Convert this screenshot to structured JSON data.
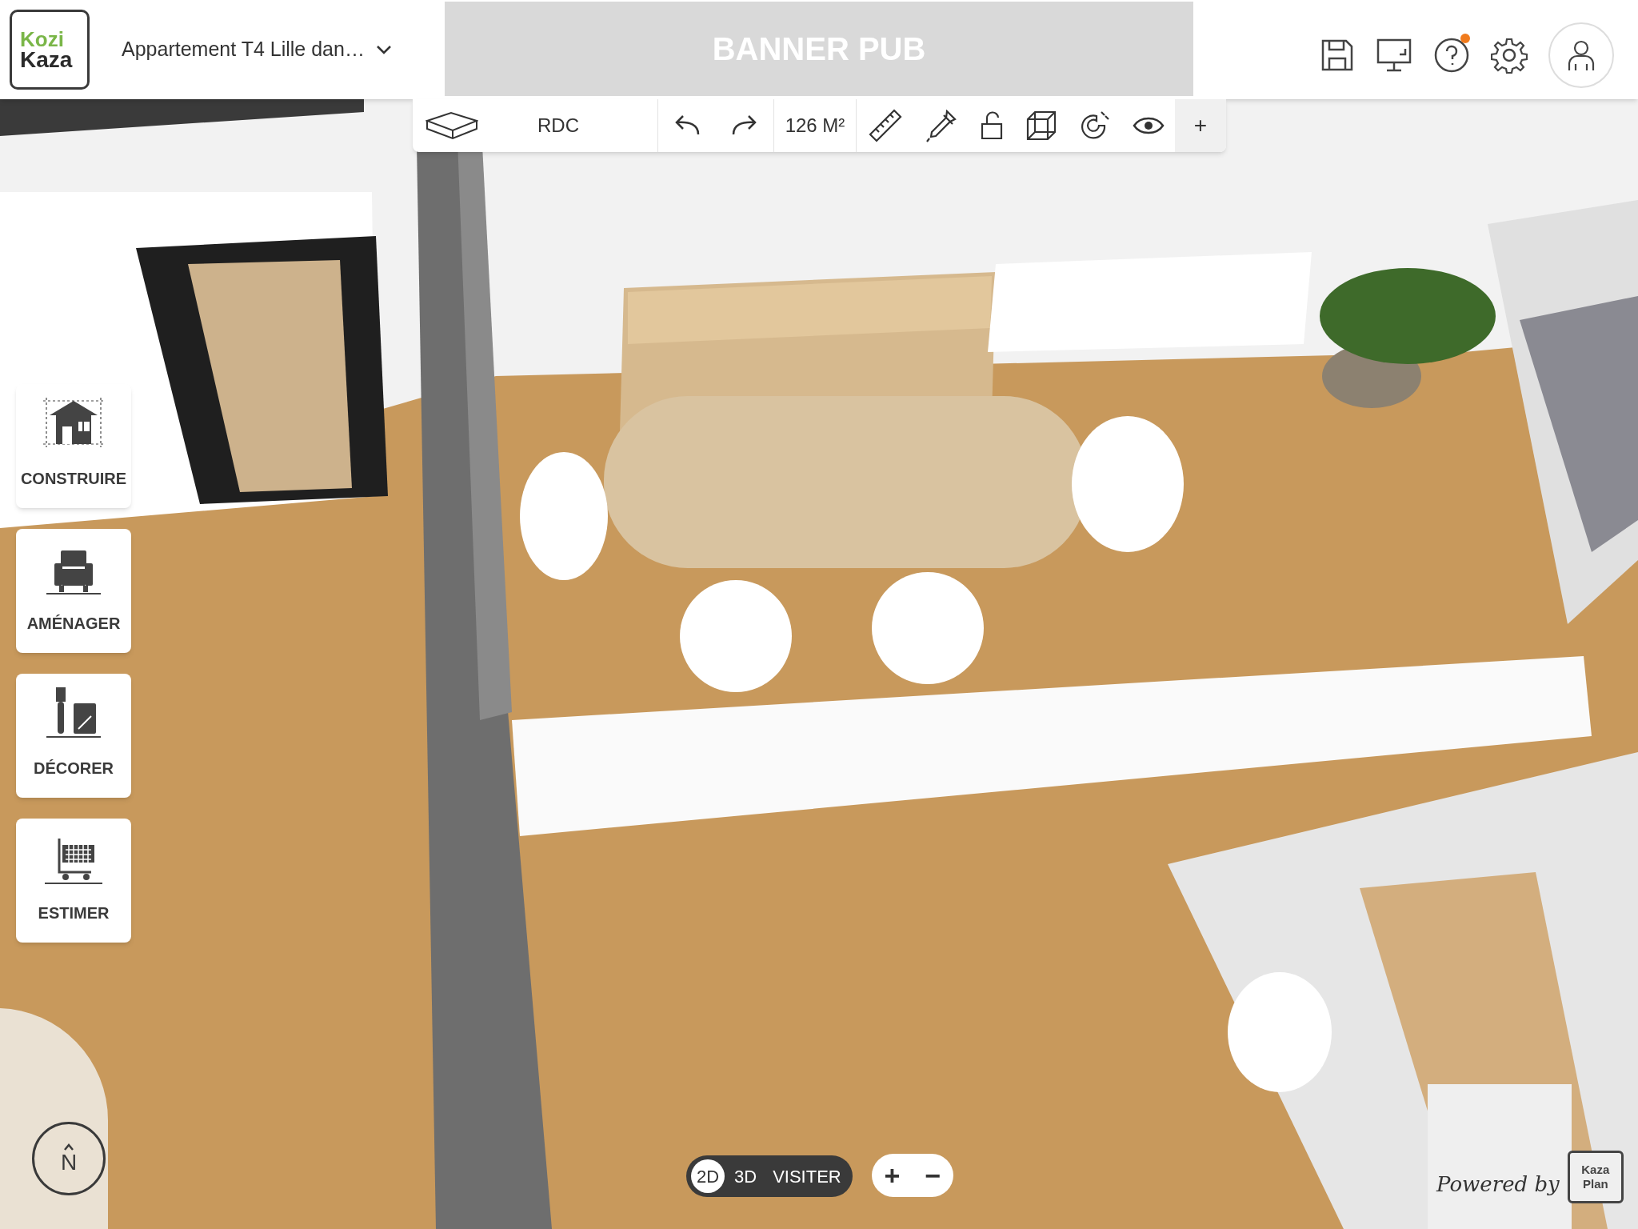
{
  "header": {
    "logo": {
      "line_1": "Kozi",
      "line_2": "Kaza"
    },
    "project_title": "Appartement T4 Lille dan…",
    "banner": "BANNER PUB",
    "help_notification": true
  },
  "toolbar": {
    "floor": "RDC",
    "area": "126 M²",
    "add": "+"
  },
  "side_menu": [
    {
      "label": "CONSTRUIRE",
      "kind": "build"
    },
    {
      "label": "AMÉNAGER",
      "kind": "furnish"
    },
    {
      "label": "DÉCORER",
      "kind": "decorate"
    },
    {
      "label": "ESTIMER",
      "kind": "estimate"
    }
  ],
  "compass": {
    "label": "N"
  },
  "view_modes": [
    {
      "label": "2D",
      "selected": true
    },
    {
      "label": "3D",
      "selected": false
    },
    {
      "label": "VISITER",
      "selected": false
    }
  ],
  "zoom": {
    "zoom_in": "+",
    "zoom_out": "−"
  },
  "credit": {
    "text": "Powered by",
    "logo_line_1": "Kaza",
    "logo_line_2": "Plan"
  }
}
